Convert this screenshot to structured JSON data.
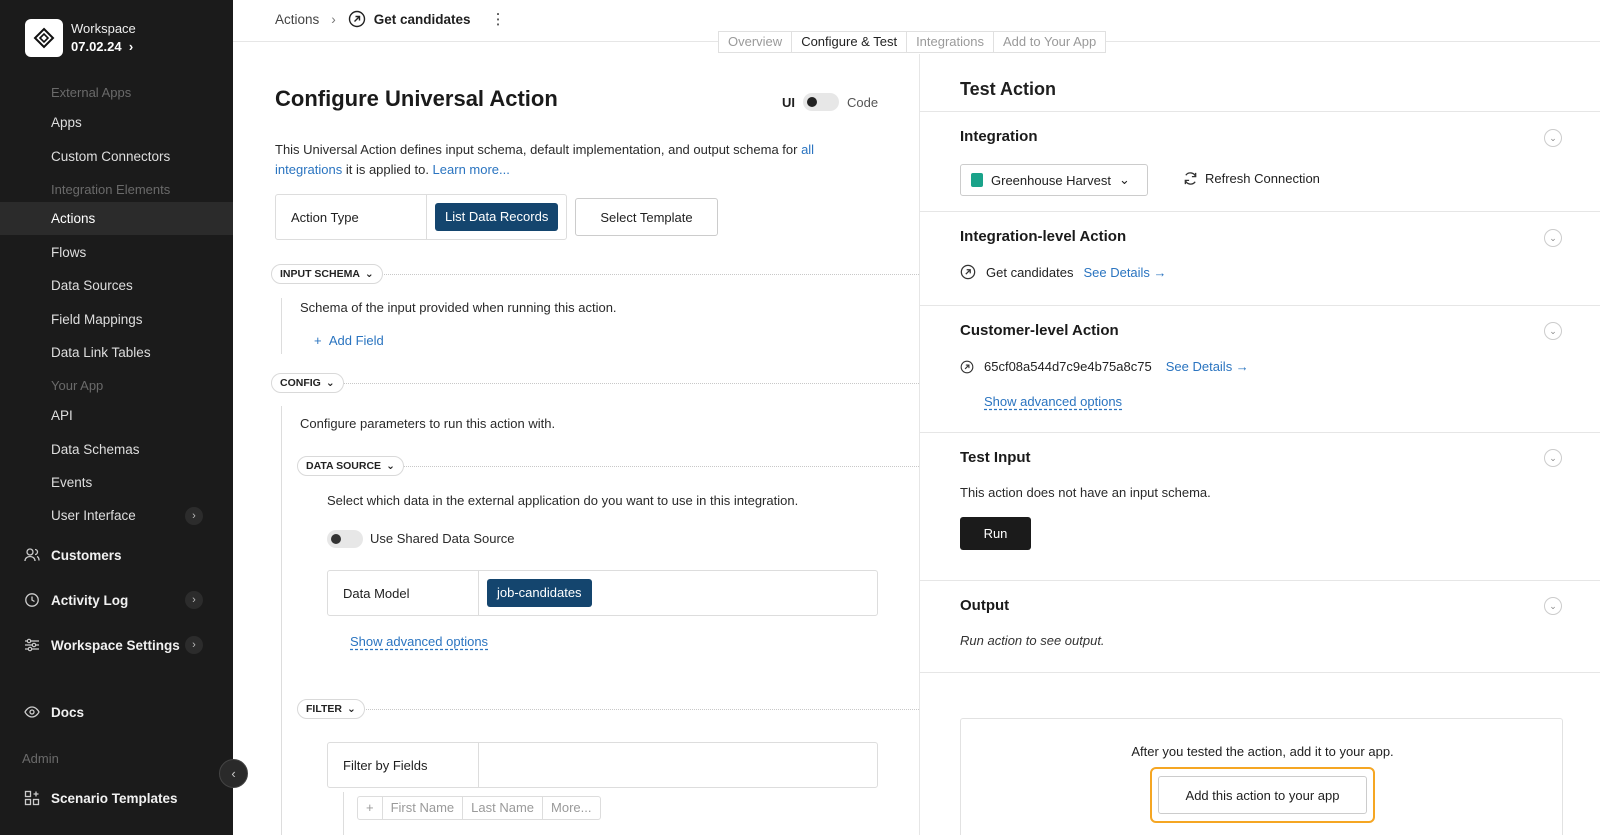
{
  "workspace": {
    "name": "Workspace",
    "date": "07.02.24"
  },
  "sidebar": {
    "external_apps_header": "External Apps",
    "apps": "Apps",
    "custom_connectors": "Custom Connectors",
    "integration_elements_header": "Integration Elements",
    "actions": "Actions",
    "flows": "Flows",
    "data_sources": "Data Sources",
    "field_mappings": "Field Mappings",
    "data_link_tables": "Data Link Tables",
    "your_app_header": "Your App",
    "api": "API",
    "data_schemas": "Data Schemas",
    "events": "Events",
    "user_interface": "User Interface",
    "customers": "Customers",
    "activity_log": "Activity Log",
    "workspace_settings": "Workspace Settings",
    "docs": "Docs",
    "admin_header": "Admin",
    "scenario_templates": "Scenario Templates"
  },
  "breadcrumb": {
    "parent": "Actions",
    "current": "Get candidates"
  },
  "tabs": [
    "Overview",
    "Configure & Test",
    "Integrations",
    "Add to Your App"
  ],
  "config": {
    "title": "Configure Universal Action",
    "mode_ui": "UI",
    "mode_code": "Code",
    "desc_pre": "This Universal Action defines input schema, default implementation, and output schema for ",
    "desc_link1": "all integrations",
    "desc_mid": " it is applied to. ",
    "desc_link2": "Learn more...",
    "action_type_label": "Action Type",
    "action_type_value": "List Data Records",
    "select_template": "Select Template",
    "input_schema_pill": "INPUT SCHEMA",
    "input_schema_desc": "Schema of the input provided when running this action.",
    "add_field": "Add Field",
    "config_pill": "CONFIG",
    "config_desc": "Configure parameters to run this action with.",
    "data_source_pill": "DATA SOURCE",
    "data_source_desc": "Select which data in the external application do you want to use in this integration.",
    "use_shared": "Use Shared Data Source",
    "data_model_label": "Data Model",
    "data_model_value": "job-candidates",
    "show_advanced": "Show advanced options",
    "filter_pill": "FILTER",
    "filter_by_fields": "Filter by Fields",
    "filter_chips": [
      "First Name",
      "Last Name",
      "More..."
    ]
  },
  "test": {
    "title": "Test Action",
    "integration_title": "Integration",
    "integration_value": "Greenhouse Harvest",
    "refresh": "Refresh Connection",
    "integration_level_title": "Integration-level Action",
    "integration_level_name": "Get candidates",
    "see_details": "See Details →",
    "customer_level_title": "Customer-level Action",
    "customer_level_id": "65cf08a544d7c9e4b75a8c75",
    "show_advanced": "Show advanced options",
    "test_input_title": "Test Input",
    "test_input_desc": "This action does not have an input schema.",
    "run": "Run",
    "output_title": "Output",
    "output_desc": "Run action to see output.",
    "add_msg": "After you tested the action, add it to your app.",
    "add_btn": "Add this action to your app"
  }
}
